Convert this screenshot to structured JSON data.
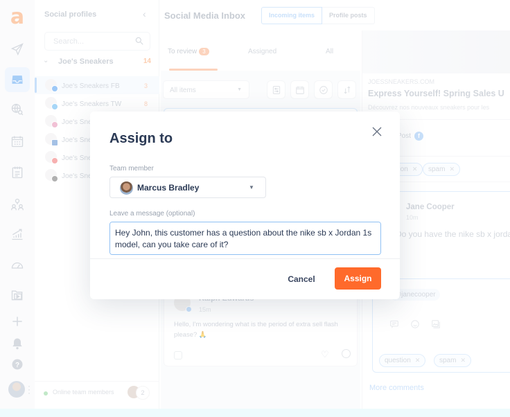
{
  "rail": {
    "logo": "a",
    "icons": [
      "send-icon",
      "inbox-icon",
      "globe-search-icon",
      "calendar-icon",
      "notepad-icon",
      "team-icon",
      "analytics-icon",
      "gauge-icon",
      "media-library-icon",
      "plus-icon",
      "bell-icon",
      "help-icon"
    ]
  },
  "profiles": {
    "title": "Social profiles",
    "search_placeholder": "Search...",
    "group": {
      "name": "Joe's Sneakers",
      "count": "14"
    },
    "items": [
      {
        "name": "Joe's Sneakers FB",
        "network": "facebook",
        "count": "3",
        "color": "#4d9cf0"
      },
      {
        "name": "Joe's Sneakers TW",
        "network": "twitter",
        "count": "8",
        "color": "#5fb4f0"
      },
      {
        "name": "Joe's Sneakers IG",
        "network": "instagram",
        "count": "",
        "color": "#e58fb2"
      },
      {
        "name": "Joe's Sneakers LI",
        "network": "linkedin",
        "count": "",
        "color": "#5a8fd0"
      },
      {
        "name": "Joe's Sneakers YT",
        "network": "youtube",
        "count": "",
        "color": "#f07070"
      },
      {
        "name": "Joe's Sneakers TT",
        "network": "tiktok",
        "count": "",
        "color": "#707070"
      }
    ],
    "online_label": "Online team members",
    "online_count": "2"
  },
  "header": {
    "title": "Social Media Inbox",
    "tabs": [
      "Incoming items",
      "Profile posts"
    ]
  },
  "list": {
    "tabs": [
      {
        "label": "To review",
        "badge": "3"
      },
      {
        "label": "Assigned"
      },
      {
        "label": "All"
      }
    ],
    "filter_value": "All items",
    "card": {
      "author": "Ralph Edwards",
      "time": "15m",
      "message": "Hello, I'm wondering what is the period of extra sell flash please? 🙏"
    }
  },
  "detail": {
    "domain": "JOESSNEAKERS.COM",
    "headline": "Express Yourself! Spring Sales U",
    "subline": "Découvrez nos nouveaux sneakers pour les",
    "post_label": "Post",
    "top_tags": [
      "question",
      "spam"
    ],
    "comment": {
      "author": "Jane Cooper",
      "time": "10m",
      "message": "Do you have the nike sb x jordan",
      "mention": "@janecooper"
    },
    "bottom_tags": [
      "question",
      "spam"
    ],
    "more_comments": "More comments"
  },
  "modal": {
    "title": "Assign to",
    "team_member_label": "Team member",
    "team_member_value": "Marcus Bradley",
    "message_label": "Leave a message (optional)",
    "message_value": "Hey John, this customer has a question about the nike sb x Jordan 1s model, can you take care of it?",
    "cancel_label": "Cancel",
    "assign_label": "Assign"
  }
}
